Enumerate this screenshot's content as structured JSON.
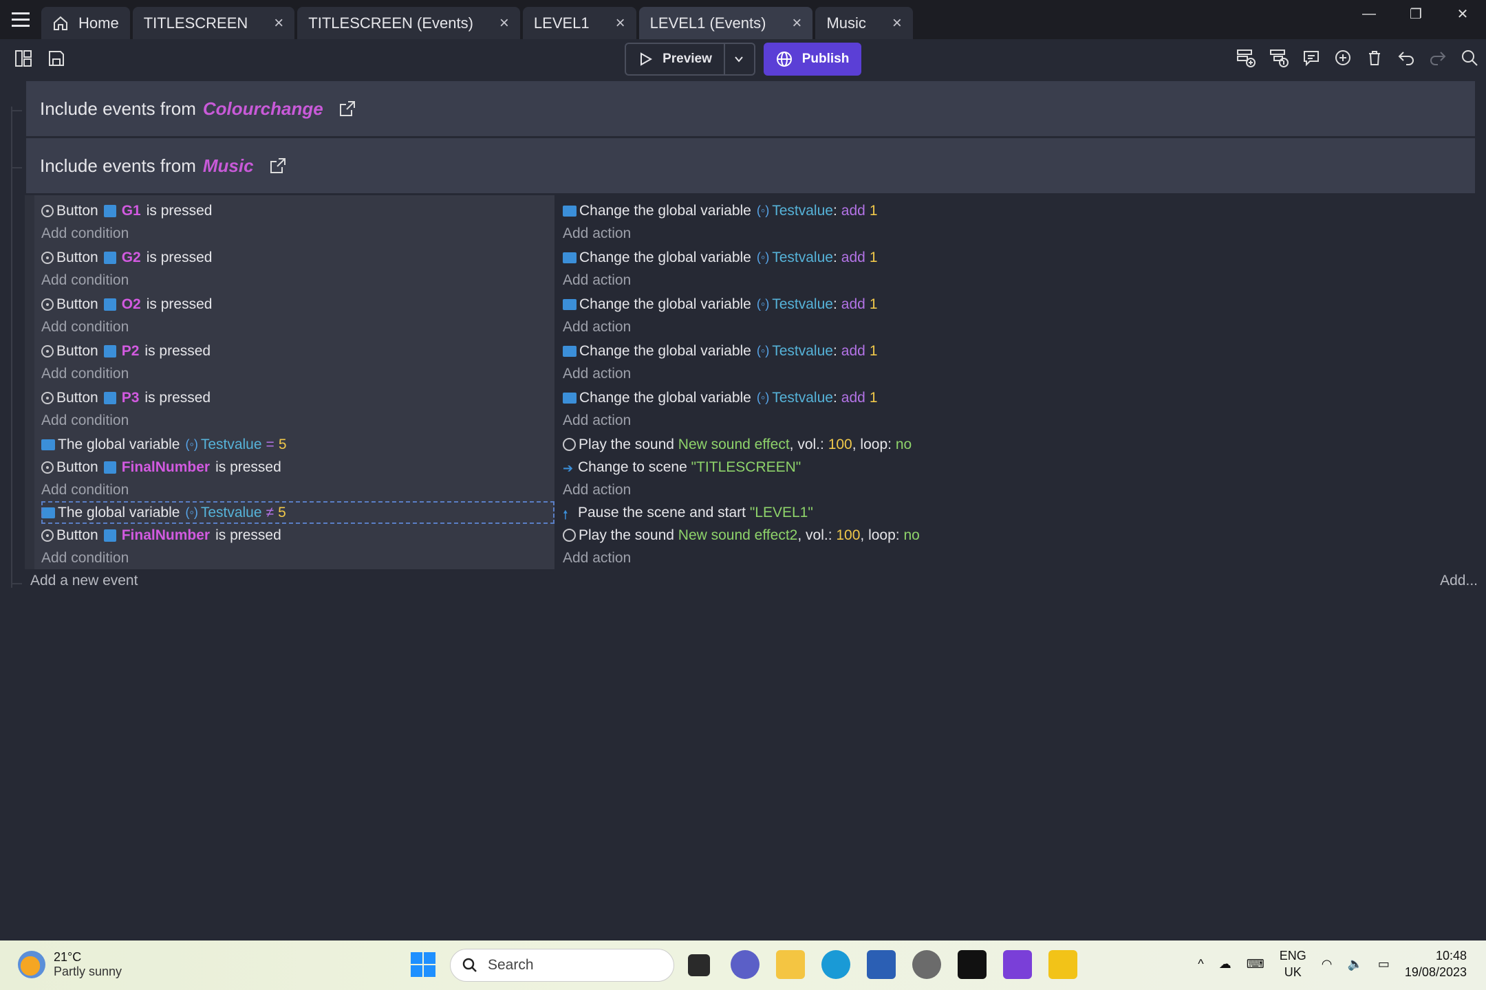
{
  "tabs": [
    {
      "label": "Home",
      "closable": false
    },
    {
      "label": "TITLESCREEN",
      "closable": true
    },
    {
      "label": "TITLESCREEN (Events)",
      "closable": true
    },
    {
      "label": "LEVEL1",
      "closable": true
    },
    {
      "label": "LEVEL1 (Events)",
      "closable": true,
      "active": true
    },
    {
      "label": "Music",
      "closable": true
    }
  ],
  "toolbar": {
    "preview": "Preview",
    "publish": "Publish"
  },
  "includes": [
    {
      "prefix": "Include events from",
      "target": "Colourchange"
    },
    {
      "prefix": "Include events from",
      "target": "Music"
    }
  ],
  "events": [
    {
      "cond_button": "Button",
      "object": "G1",
      "pressed": "is pressed",
      "act_text": "Change the global variable",
      "var": "Testvalue",
      "op": "add",
      "value": "1"
    },
    {
      "cond_button": "Button",
      "object": "G2",
      "pressed": "is pressed",
      "act_text": "Change the global variable",
      "var": "Testvalue",
      "op": "add",
      "value": "1"
    },
    {
      "cond_button": "Button",
      "object": "O2",
      "pressed": "is pressed",
      "act_text": "Change the global variable",
      "var": "Testvalue",
      "op": "add",
      "value": "1"
    },
    {
      "cond_button": "Button",
      "object": "P2",
      "pressed": "is pressed",
      "act_text": "Change the global variable",
      "var": "Testvalue",
      "op": "add",
      "value": "1"
    },
    {
      "cond_button": "Button",
      "object": "P3",
      "pressed": "is pressed",
      "act_text": "Change the global variable",
      "var": "Testvalue",
      "op": "add",
      "value": "1"
    }
  ],
  "event6": {
    "cond1": "The global variable",
    "var": "Testvalue",
    "op": "=",
    "value": "5",
    "cond2": "Button",
    "object": "FinalNumber",
    "pressed": "is pressed",
    "act1": "Play the sound",
    "sound": "New sound effect",
    "vol_label": ", vol.:",
    "vol": "100",
    "loop_label": ", loop:",
    "loop": "no",
    "act2": "Change to scene",
    "scene": "\"TITLESCREEN\""
  },
  "event7": {
    "cond1": "The global variable",
    "var": "Testvalue",
    "op": "≠",
    "value": "5",
    "cond2": "Button",
    "object": "FinalNumber",
    "pressed": "is pressed",
    "act1": "Pause the scene and start",
    "scene": "\"LEVEL1\"",
    "act2": "Play the sound",
    "sound": "New sound effect2",
    "vol_label": ", vol.:",
    "vol": "100",
    "loop_label": ", loop:",
    "loop": "no"
  },
  "labels": {
    "add_condition": "Add condition",
    "add_action": "Add action",
    "add_event": "Add a new event",
    "add_more": "Add..."
  },
  "taskbar": {
    "temp": "21°C",
    "weather": "Partly sunny",
    "search": "Search",
    "lang1": "ENG",
    "lang2": "UK",
    "time": "10:48",
    "date": "19/08/2023"
  }
}
